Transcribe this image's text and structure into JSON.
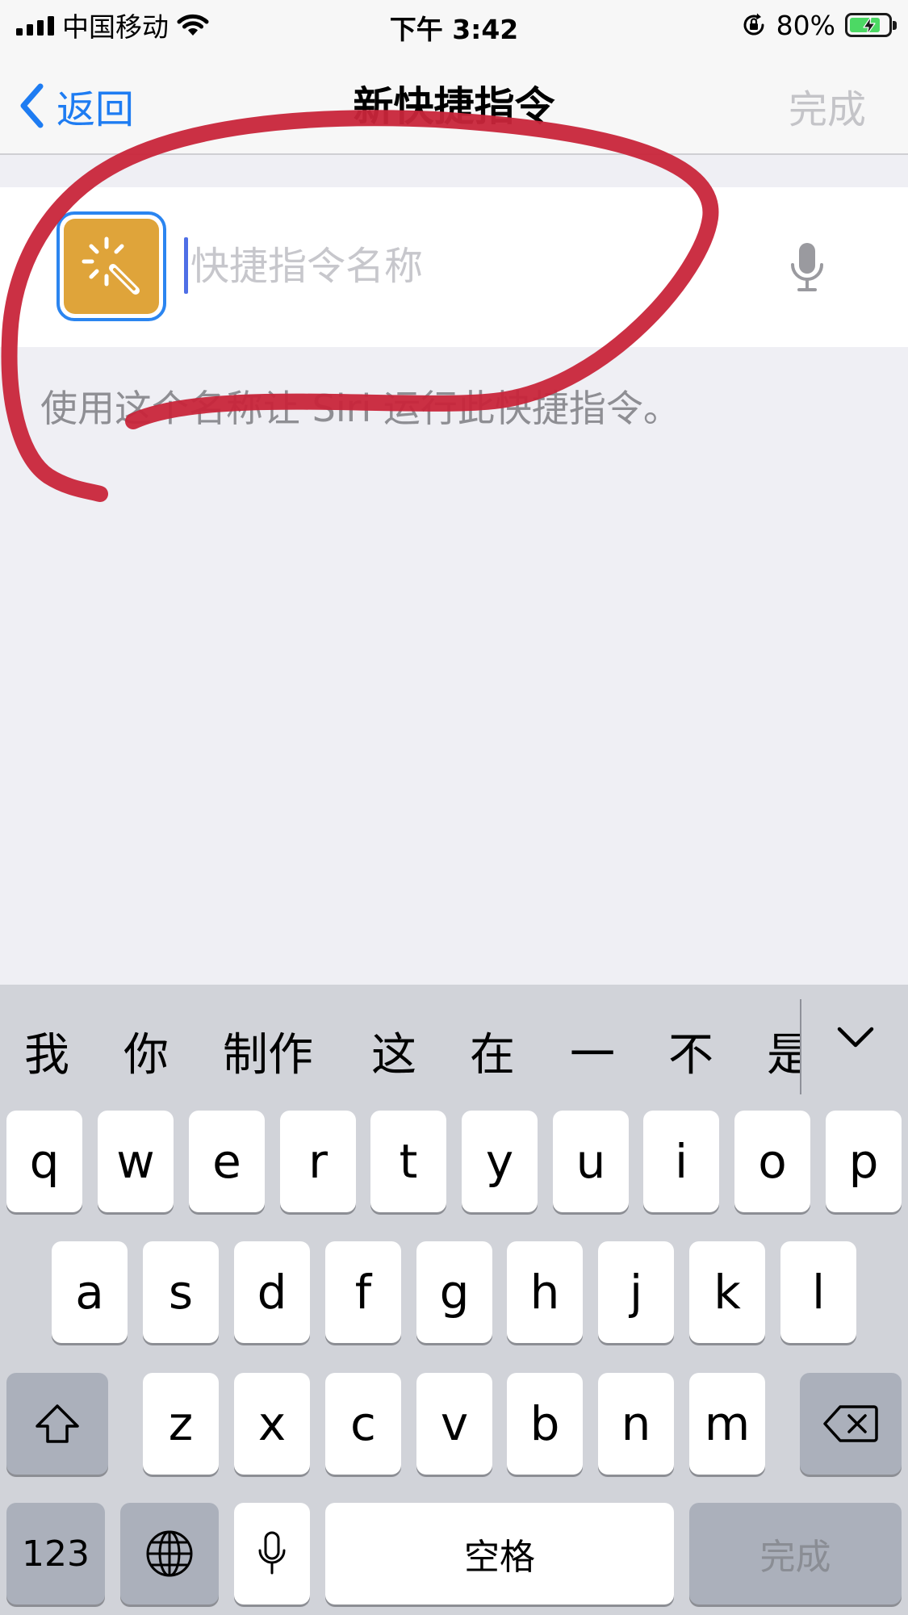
{
  "status_bar": {
    "carrier": "中国移动",
    "time": "下午 3:42",
    "battery": "80%",
    "battery_level": 0.8,
    "icons": [
      "signal-bars-icon",
      "wifi-icon",
      "orientation-lock-icon",
      "battery-charging-icon"
    ]
  },
  "nav": {
    "back_label": "返回",
    "title": "新快捷指令",
    "done_label": "完成"
  },
  "name_row": {
    "placeholder": "快捷指令名称",
    "value": "",
    "icon": "magic-wand-icon",
    "icon_color": "#dfa43a"
  },
  "hint": "使用这个名称让 Siri 运行此快捷指令。",
  "annotation": {
    "color": "#c8253a",
    "shape": "hand-drawn loop"
  },
  "keyboard": {
    "candidates": [
      "我",
      "你",
      "制作",
      "这",
      "在",
      "一",
      "不",
      "是"
    ],
    "row1": [
      "q",
      "w",
      "e",
      "r",
      "t",
      "y",
      "u",
      "i",
      "o",
      "p"
    ],
    "row2": [
      "a",
      "s",
      "d",
      "f",
      "g",
      "h",
      "j",
      "k",
      "l"
    ],
    "row3": [
      "z",
      "x",
      "c",
      "v",
      "b",
      "n",
      "m"
    ],
    "numbers_label": "123",
    "space_label": "空格",
    "return_label": "完成"
  },
  "colors": {
    "accent": "#1e7cf2",
    "background": "#efeff4",
    "keyboard": "#d1d3d9"
  }
}
